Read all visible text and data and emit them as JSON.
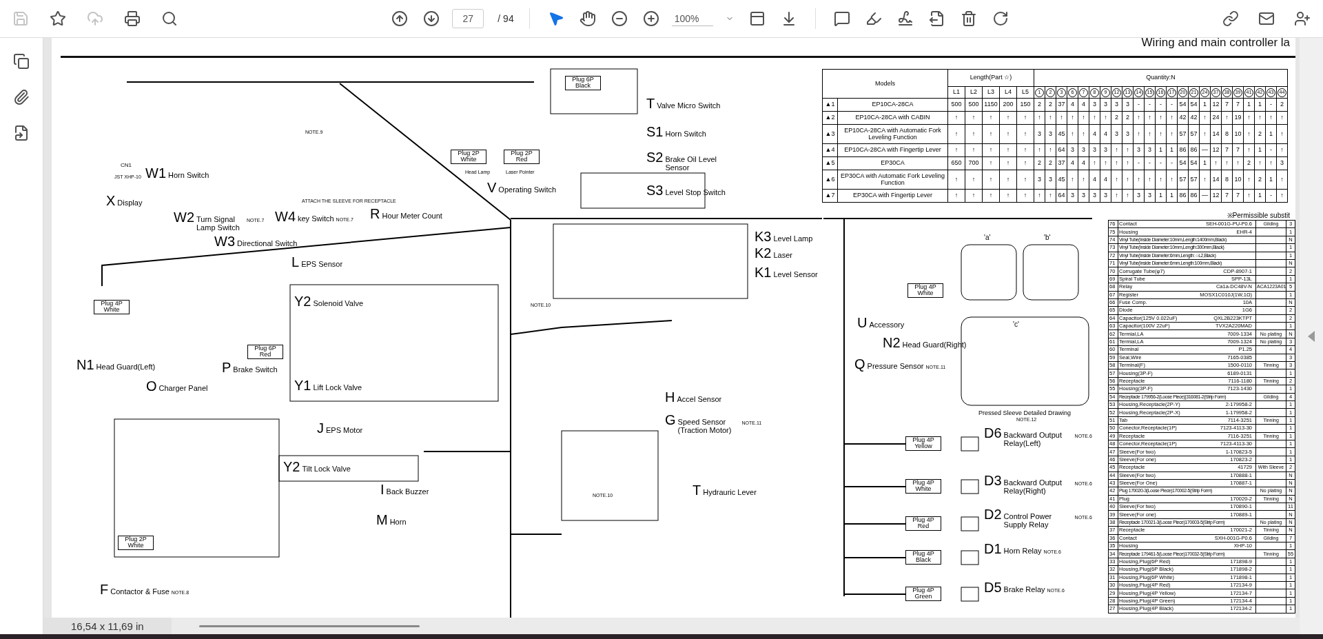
{
  "toolbar": {
    "file_tools": [
      {
        "disabled": true
      },
      {
        "disabled": false
      },
      {
        "disabled": true
      },
      {
        "disabled": false
      },
      {
        "disabled": false
      }
    ],
    "page_field": {
      "value": "27"
    },
    "page_total": "/ 94",
    "pointer_tools": [
      {
        "selected": true
      },
      {
        "selected": false
      }
    ],
    "zoom_field": {
      "value": "100%"
    }
  },
  "document": {
    "title": "Wiring and main controller la",
    "models_table": {
      "models_heading": "Models",
      "length_heading": "Length(Part ☆)",
      "quantity_heading": "Quantity:N",
      "length_columns": [
        "L1",
        "L2",
        "L3",
        "L4",
        "L5"
      ],
      "part_columns": [
        "1",
        "2",
        "3",
        "6",
        "7",
        "8",
        "9",
        "12",
        "13",
        "14",
        "15",
        "16",
        "17",
        "20",
        "21",
        "24",
        "37",
        "38",
        "39",
        "41",
        "42",
        "43",
        "44"
      ],
      "rows": [
        {
          "mark": "▲1",
          "model": "EP10CA-28CA",
          "lengths": [
            "500",
            "500",
            "1150",
            "200",
            "150"
          ],
          "quantities": [
            "2",
            "2",
            "37",
            "4",
            "4",
            "3",
            "3",
            "3",
            "3",
            "-",
            "-",
            "-",
            "-",
            "54",
            "54",
            "1",
            "12",
            "7",
            "7",
            "1",
            "1",
            "-",
            "2"
          ]
        },
        {
          "mark": "▲2",
          "model": "EP10CA-28CA with CABIN",
          "lengths": [
            "↑",
            "↑",
            "↑",
            "↑",
            "↑"
          ],
          "quantities": [
            "↑",
            "↑",
            "↑",
            "↑",
            "↑",
            "↑",
            "↑",
            "2",
            "2",
            "↑",
            "↑",
            "↑",
            "↑",
            "42",
            "42",
            "↑",
            "24",
            "↑",
            "19",
            "↑",
            "↑",
            "↑",
            "↑"
          ]
        },
        {
          "mark": "▲3",
          "model": "EP10CA-28CA with Automatic Fork Leveling Function",
          "lengths": [
            "↑",
            "↑",
            "↑",
            "↑",
            "↑"
          ],
          "quantities": [
            "3",
            "3",
            "45",
            "↑",
            "↑",
            "4",
            "4",
            "3",
            "3",
            "↑",
            "↑",
            "↑",
            "↑",
            "57",
            "57",
            "↑",
            "14",
            "8",
            "10",
            "↑",
            "2",
            "1",
            "↑"
          ]
        },
        {
          "mark": "▲4",
          "model": "EP10CA-28CA with Fingertip Lever",
          "lengths": [
            "↑",
            "↑",
            "↑",
            "↑",
            "↑"
          ],
          "quantities": [
            "↑",
            "↑",
            "64",
            "3",
            "3",
            "3",
            "3",
            "↑",
            "↑",
            "3",
            "3",
            "1",
            "1",
            "86",
            "86",
            "—",
            "12",
            "7",
            "7",
            "↑",
            "1",
            "-",
            "↑"
          ]
        },
        {
          "mark": "▲5",
          "model": "EP30CA",
          "lengths": [
            "650",
            "700",
            "↑",
            "↑",
            "↑"
          ],
          "quantities": [
            "2",
            "2",
            "37",
            "4",
            "4",
            "↑",
            "↑",
            "↑",
            "↑",
            "-",
            "-",
            "-",
            "-",
            "54",
            "54",
            "1",
            "↑",
            "↑",
            "↑",
            "2",
            "↑",
            "↑",
            "3"
          ]
        },
        {
          "mark": "▲6",
          "model": "EP30CA with Automatic Fork Leveling Function",
          "lengths": [
            "↑",
            "↑",
            "↑",
            "↑",
            "↑"
          ],
          "quantities": [
            "3",
            "3",
            "45",
            "↑",
            "↑",
            "4",
            "4",
            "↑",
            "↑",
            "↑",
            "↑",
            "↑",
            "↑",
            "57",
            "57",
            "↑",
            "14",
            "8",
            "10",
            "↑",
            "2",
            "1",
            "↑"
          ]
        },
        {
          "mark": "▲7",
          "model": "EP30CA with Fingertip Lever",
          "lengths": [
            "↑",
            "↑",
            "↑",
            "↑",
            "↑"
          ],
          "quantities": [
            "↑",
            "↑",
            "64",
            "3",
            "3",
            "3",
            "3",
            "↑",
            "↑",
            "3",
            "3",
            "1",
            "1",
            "86",
            "86",
            "—",
            "12",
            "7",
            "7",
            "↑",
            "1",
            "-",
            "↑"
          ]
        }
      ]
    },
    "parts_heading": "※Permissible substit",
    "parts": [
      {
        "no": "76",
        "name": "Contact",
        "part": "SEH-001G-PU-P0.6",
        "note": "Gilding",
        "qty": "3"
      },
      {
        "no": "75",
        "name": "Housing",
        "part": "EHR-4",
        "qty": "1"
      },
      {
        "no": "74",
        "name": "Vinyl Tube(Inside Diameter:10mm,Length:1400mm,Black)",
        "qty": "N"
      },
      {
        "no": "73",
        "name": "Vinyl Tube(Inside Diameter:10mm,Length:300mm,Black)",
        "qty": "1"
      },
      {
        "no": "72",
        "name": "Vinyl Tube(Inside Diameter:6mm,Length:☆L2,Black)",
        "qty": "1"
      },
      {
        "no": "71",
        "name": "Vinyl Tube(Inside Diameter:6mm,Length:100mm,Black)",
        "qty": "N"
      },
      {
        "no": "70",
        "name": "Corrugate Tube(φ7)",
        "part": "CDP-8907-1",
        "qty": "2"
      },
      {
        "no": "69",
        "name": "Spiral Tube",
        "part": "SPP-13L",
        "qty": "1"
      },
      {
        "no": "68",
        "name": "Relay",
        "part": "Ca1a-DC48V-N",
        "note": "ACA1223A01",
        "qty": "5"
      },
      {
        "no": "67",
        "name": "Register",
        "part": "MOSX1C010J(1W,1Ω)",
        "qty": "1"
      },
      {
        "no": "66",
        "name": "Fuse Comp.",
        "part": "10A",
        "qty": "N"
      },
      {
        "no": "65",
        "name": "Diode",
        "part": "1G6",
        "qty": "2"
      },
      {
        "no": "64",
        "name": "Capacitor(125V 0.022uF)",
        "part": "QXL2B223KTPT",
        "qty": "2"
      },
      {
        "no": "63",
        "name": "Capacitor(100V 22uF)",
        "part": "TVX2A220MAD",
        "qty": "1"
      },
      {
        "no": "62",
        "name": "Termial,LA",
        "part": "7009-1334",
        "note": "No plating",
        "qty": "N"
      },
      {
        "no": "61",
        "name": "Termial,LA",
        "part": "7009-1324",
        "note": "No plating",
        "qty": "3"
      },
      {
        "no": "60",
        "name": "Terminal",
        "part": "P1.25",
        "qty": "4"
      },
      {
        "no": "59",
        "name": "Seal,Wire",
        "part": "7165-0385",
        "qty": "3"
      },
      {
        "no": "58",
        "name": "Terminal(F)",
        "part": "1500-0110",
        "note": "Tinning",
        "qty": "3"
      },
      {
        "no": "57",
        "name": "Housing(3P-F)",
        "part": "6189-0131",
        "qty": "1"
      },
      {
        "no": "56",
        "name": "Receptacle",
        "part": "7116-1180",
        "note": "Tinning",
        "qty": "2"
      },
      {
        "no": "55",
        "name": "Housing(3P-F)",
        "part": "7123-1430",
        "qty": "1"
      },
      {
        "no": "54",
        "name": "Receptacle 179956-2(Loose Piece)(316081-2(Strip Form)",
        "note": "Gilding",
        "qty": "4"
      },
      {
        "no": "53",
        "name": "Housing,Receptacle(2P-Y)",
        "part": "2-179958-2",
        "qty": "1"
      },
      {
        "no": "52",
        "name": "Housing,Receptacle(2P-X)",
        "part": "1-179958-2",
        "qty": "1"
      },
      {
        "no": "51",
        "name": "Tab",
        "part": "7114-3251",
        "note": "Tinning",
        "qty": "1"
      },
      {
        "no": "50",
        "name": "Conector,Receptacle(1P)",
        "part": "7123-4113-30",
        "qty": "1"
      },
      {
        "no": "49",
        "name": "Receptacle",
        "part": "7116-3251",
        "note": "Tinning",
        "qty": "1"
      },
      {
        "no": "48",
        "name": "Conector,Receptacle(1P)",
        "part": "7123-4113-30",
        "qty": "1"
      },
      {
        "no": "47",
        "name": "Sleeve(For two)",
        "part": "1-170823-5",
        "qty": "1"
      },
      {
        "no": "46",
        "name": "Sleeve(For one)",
        "part": "170823-2",
        "qty": "1"
      },
      {
        "no": "45",
        "name": "Receptacle",
        "part": "41729",
        "note": "With Sleeve",
        "qty": "2"
      },
      {
        "no": "44",
        "name": "Sleeve(For two)",
        "part": "170888-1",
        "qty": "N"
      },
      {
        "no": "43",
        "name": "Sleeve(For One)",
        "part": "170887-1",
        "qty": "N"
      },
      {
        "no": "42",
        "name": "Plug 170020-3(Loose Piece)170002-5(Strip Form)",
        "note": "No plating",
        "qty": "N"
      },
      {
        "no": "41",
        "name": "Plug",
        "part": "170020-2",
        "note": "Tinning",
        "qty": "N"
      },
      {
        "no": "40",
        "name": "Sleeve(For two)",
        "part": "170890-1",
        "qty": "11"
      },
      {
        "no": "39",
        "name": "Sleeve(For one)",
        "part": "170889-1",
        "qty": "N"
      },
      {
        "no": "38",
        "name": "Receptacle 170021-3(Loose Piece)170003-5(Strip Form)",
        "note": "No plating",
        "qty": "N"
      },
      {
        "no": "37",
        "name": "Receptacle",
        "part": "170021-2",
        "note": "Tinning",
        "qty": "N"
      },
      {
        "no": "36",
        "name": "Contact",
        "part": "SXH-001G-P0.6",
        "note": "Gilding",
        "qty": "7"
      },
      {
        "no": "35",
        "name": "Housing",
        "part": "XHP-10",
        "qty": "1"
      },
      {
        "no": "34",
        "name": "Receptacle 179461-5(Loose Piece)170032-5(Strip Form)",
        "note": "Tinning",
        "qty": "55"
      },
      {
        "no": "33",
        "name": "Housing,Plug(6P Red)",
        "part": "171898-9",
        "qty": "1"
      },
      {
        "no": "32",
        "name": "Housing,Plug(6P Black)",
        "part": "171898-2",
        "qty": "1"
      },
      {
        "no": "31",
        "name": "Housing,Plug(6P White)",
        "part": "171898-1",
        "qty": "1"
      },
      {
        "no": "30",
        "name": "Housing,Plug(4P Red)",
        "part": "172134-9",
        "qty": "1"
      },
      {
        "no": "29",
        "name": "Housing,Plug(4P Yellow)",
        "part": "172134-7",
        "qty": "1"
      },
      {
        "no": "28",
        "name": "Housing,Plug(4P Green)",
        "part": "172134-4",
        "qty": "1"
      },
      {
        "no": "27",
        "name": "Housing,Plug(4P Black)",
        "part": "172134-2",
        "qty": "1"
      }
    ],
    "components": [
      {
        "code": "X",
        "name": "Display"
      },
      {
        "code": "W1",
        "name": "Horn Switch"
      },
      {
        "code": "W2",
        "name": "Turn Signal Lamp Switch",
        "note": "NOTE.7"
      },
      {
        "code": "W3",
        "name": "Directional Switch"
      },
      {
        "code": "W4",
        "name": "key Switch",
        "note": "NOTE.7"
      },
      {
        "code": "R",
        "name": "Hour Meter Count"
      },
      {
        "code": "V",
        "name": "Operating Switch"
      },
      {
        "code": "T",
        "name": "Valve Micro Switch"
      },
      {
        "code": "S1",
        "name": "Horn Switch"
      },
      {
        "code": "S2",
        "name": "Brake Oil Level Sensor"
      },
      {
        "code": "S3",
        "name": "Level Stop Switch"
      },
      {
        "code": "K3",
        "name": "Level Lamp"
      },
      {
        "code": "K2",
        "name": "Laser"
      },
      {
        "code": "K1",
        "name": "Level Sensor"
      },
      {
        "code": "L",
        "name": "EPS Sensor"
      },
      {
        "code": "Y2",
        "name": "Solenoid Valve"
      },
      {
        "code": "Y1",
        "name": "Lift Lock Valve"
      },
      {
        "code": "N1",
        "name": "Head Guard(Left)"
      },
      {
        "code": "O",
        "name": "Charger Panel"
      },
      {
        "code": "P",
        "name": "Brake Switch"
      },
      {
        "code": "U",
        "name": "Accessory"
      },
      {
        "code": "N2",
        "name": "Head Guard(Right)"
      },
      {
        "code": "Q",
        "name": "Pressure Sensor",
        "note": "NOTE.11"
      },
      {
        "code": "H",
        "name": "Accel Sensor"
      },
      {
        "code": "J",
        "name": "EPS Motor"
      },
      {
        "code": "G",
        "name": "Speed Sensor (Traction Motor)",
        "note": "NOTE.11"
      },
      {
        "code": "Y2",
        "name": "Tilt Lock Valve"
      },
      {
        "code": "I",
        "name": "Back Buzzer"
      },
      {
        "code": "M",
        "name": "Horn"
      },
      {
        "code": "T",
        "name": "Hydrauric Lever"
      },
      {
        "code": "F",
        "name": "Contactor & Fuse",
        "note": "NOTE.8"
      },
      {
        "code": "D6",
        "name": "Backward Output Relay(Left)",
        "note": "NOTE.6"
      },
      {
        "code": "D3",
        "name": "Backward Output Relay(Right)",
        "note": "NOTE.6"
      },
      {
        "code": "D2",
        "name": "Control Power Supply Relay",
        "note": "NOTE.6"
      },
      {
        "code": "D1",
        "name": "Horn Relay",
        "note": "NOTE.6"
      },
      {
        "code": "D5",
        "name": "Brake Relay",
        "note": "NOTE.6"
      }
    ],
    "plugs": [
      "Plug 2P White",
      "Plug 2P Red",
      "Plug 6P Black",
      "Plug 4P White",
      "Plug 6P Red",
      "Plug 4P White",
      "Plug 4P Yellow",
      "Plug 4P White",
      "Plug 4P Red",
      "Plug 4P Black",
      "Plug 4P Green",
      "Plug 2P White"
    ],
    "notes": [
      "NOTE.9",
      "NOTE.10",
      "NOTE.10",
      "ATTACH THE SLEEVE FOR RECEPTACLE",
      "Pressed Sleeve Detailed Drawing",
      "NOTE.12",
      "'a'",
      "'b'",
      "'c'",
      "CN1",
      "JST XHP-10",
      "Head Lamp",
      "Laser Pointer"
    ]
  },
  "status_bar": {
    "page_size": "16,54 x 11,69 in"
  }
}
